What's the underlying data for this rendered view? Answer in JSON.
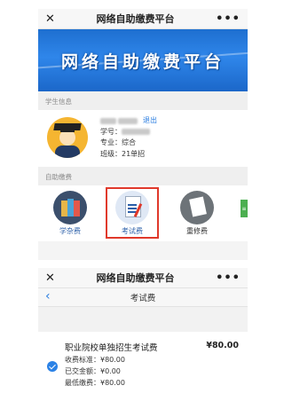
{
  "screen1": {
    "title": "网络自助缴费平台",
    "close_icon": "close-icon",
    "more_icon": "more-icon",
    "banner_text": "网络自助缴费平台",
    "student_section_label": "学生信息",
    "student": {
      "logout_label": "退出",
      "student_id_label": "学号：",
      "major": "专业：综合",
      "class": "班级：21单招"
    },
    "payment_section_label": "自助缴费",
    "payment_items": [
      {
        "label": "学杂费",
        "icon": "books-icon"
      },
      {
        "label": "考试费",
        "icon": "exam-paper-icon"
      },
      {
        "label": "重修费",
        "icon": "redo-document-icon"
      }
    ]
  },
  "screen2": {
    "title": "网络自助缴费平台",
    "page_title": "考试费",
    "item": {
      "name": "职业院校单独招生考试费",
      "price": "¥80.00",
      "standard": "收费标准：¥80.00",
      "paid": "已交金额：¥0.00",
      "minimum": "最低缴费：¥80.00"
    }
  },
  "colors": {
    "accent_blue": "#2b7ee0",
    "highlight_red": "#e0392b",
    "banner_blue": "#1e6fd0"
  }
}
